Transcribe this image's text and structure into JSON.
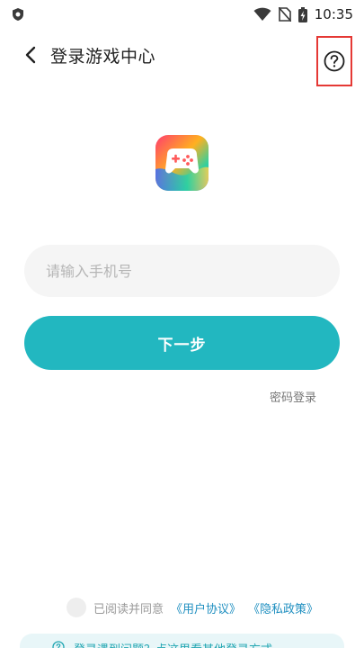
{
  "status_bar": {
    "time": "10:35",
    "icons": [
      "app-shield-icon",
      "wifi-icon",
      "no-sim-icon",
      "battery-charging-icon"
    ]
  },
  "header": {
    "title": "登录游戏中心",
    "back_icon": "chevron-left-icon",
    "help_icon": "question-circle-icon"
  },
  "logo": {
    "icon": "gamepad-icon",
    "colors": [
      "#ff3d6e",
      "#ffb020",
      "#2fd0a0",
      "#3a6cff"
    ]
  },
  "login": {
    "phone_placeholder": "请输入手机号",
    "phone_value": "",
    "next_label": "下一步",
    "password_login_label": "密码登录"
  },
  "agreement": {
    "prefix": "已阅读并同意",
    "user_agreement": "《用户协议》",
    "privacy_policy": "《隐私政策》",
    "checked": false
  },
  "help_banner": {
    "text": "登录遇到问题？点这里看其他登录方式"
  },
  "colors": {
    "accent": "#22b7c0",
    "link": "#1f8fc0",
    "help_highlight": "#e53935"
  }
}
